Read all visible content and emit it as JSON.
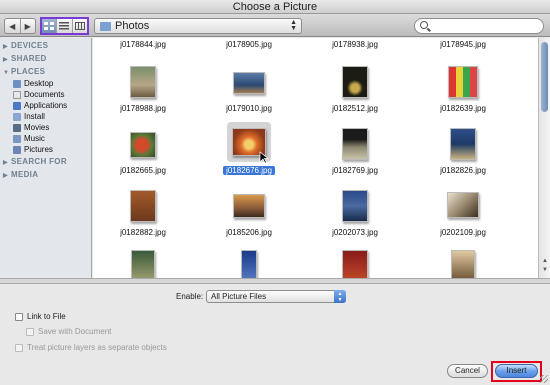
{
  "window": {
    "title": "Choose a Picture"
  },
  "toolbar": {
    "back_icon": "back-arrow-icon",
    "forward_icon": "forward-arrow-icon",
    "view_modes": [
      "icon-view",
      "list-view",
      "column-view"
    ],
    "path_label": "Photos",
    "search_placeholder": ""
  },
  "sidebar": {
    "sections": [
      {
        "label": "DEVICES",
        "items": []
      },
      {
        "label": "SHARED",
        "items": []
      },
      {
        "label": "PLACES",
        "items": [
          {
            "label": "Desktop",
            "icon": "desktop-icon"
          },
          {
            "label": "Documents",
            "icon": "documents-folder-icon"
          },
          {
            "label": "Applications",
            "icon": "applications-folder-icon"
          },
          {
            "label": "Install",
            "icon": "install-folder-icon"
          },
          {
            "label": "Movies",
            "icon": "movies-folder-icon"
          },
          {
            "label": "Music",
            "icon": "music-folder-icon"
          },
          {
            "label": "Pictures",
            "icon": "pictures-folder-icon"
          }
        ]
      },
      {
        "label": "SEARCH FOR",
        "items": []
      },
      {
        "label": "MEDIA",
        "items": []
      }
    ]
  },
  "files": {
    "row0": [
      "j0178844.jpg",
      "j0178905.jpg",
      "j0178938.jpg",
      "j0178945.jpg"
    ],
    "row1": [
      "j0178988.jpg",
      "j0179010.jpg",
      "j0182512.jpg",
      "j0182639.jpg"
    ],
    "row2": [
      "j0182665.jpg",
      "j0182676.jpg",
      "j0182769.jpg",
      "j0182826.jpg"
    ],
    "row3": [
      "j0182882.jpg",
      "j0185206.jpg",
      "j0202073.jpg",
      "j0202109.jpg"
    ],
    "selected": "j0182676.jpg"
  },
  "options": {
    "enable_label": "Enable:",
    "enable_value": "All Picture Files",
    "link_to_file": "Link to File",
    "save_with_document": "Save with Document",
    "treat_layers": "Treat picture layers as separate objects"
  },
  "buttons": {
    "cancel": "Cancel",
    "insert": "Insert"
  },
  "colors": {
    "selection": "#3875d7",
    "highlight_view": "#7a3ad6",
    "highlight_insert": "#e3001b"
  }
}
